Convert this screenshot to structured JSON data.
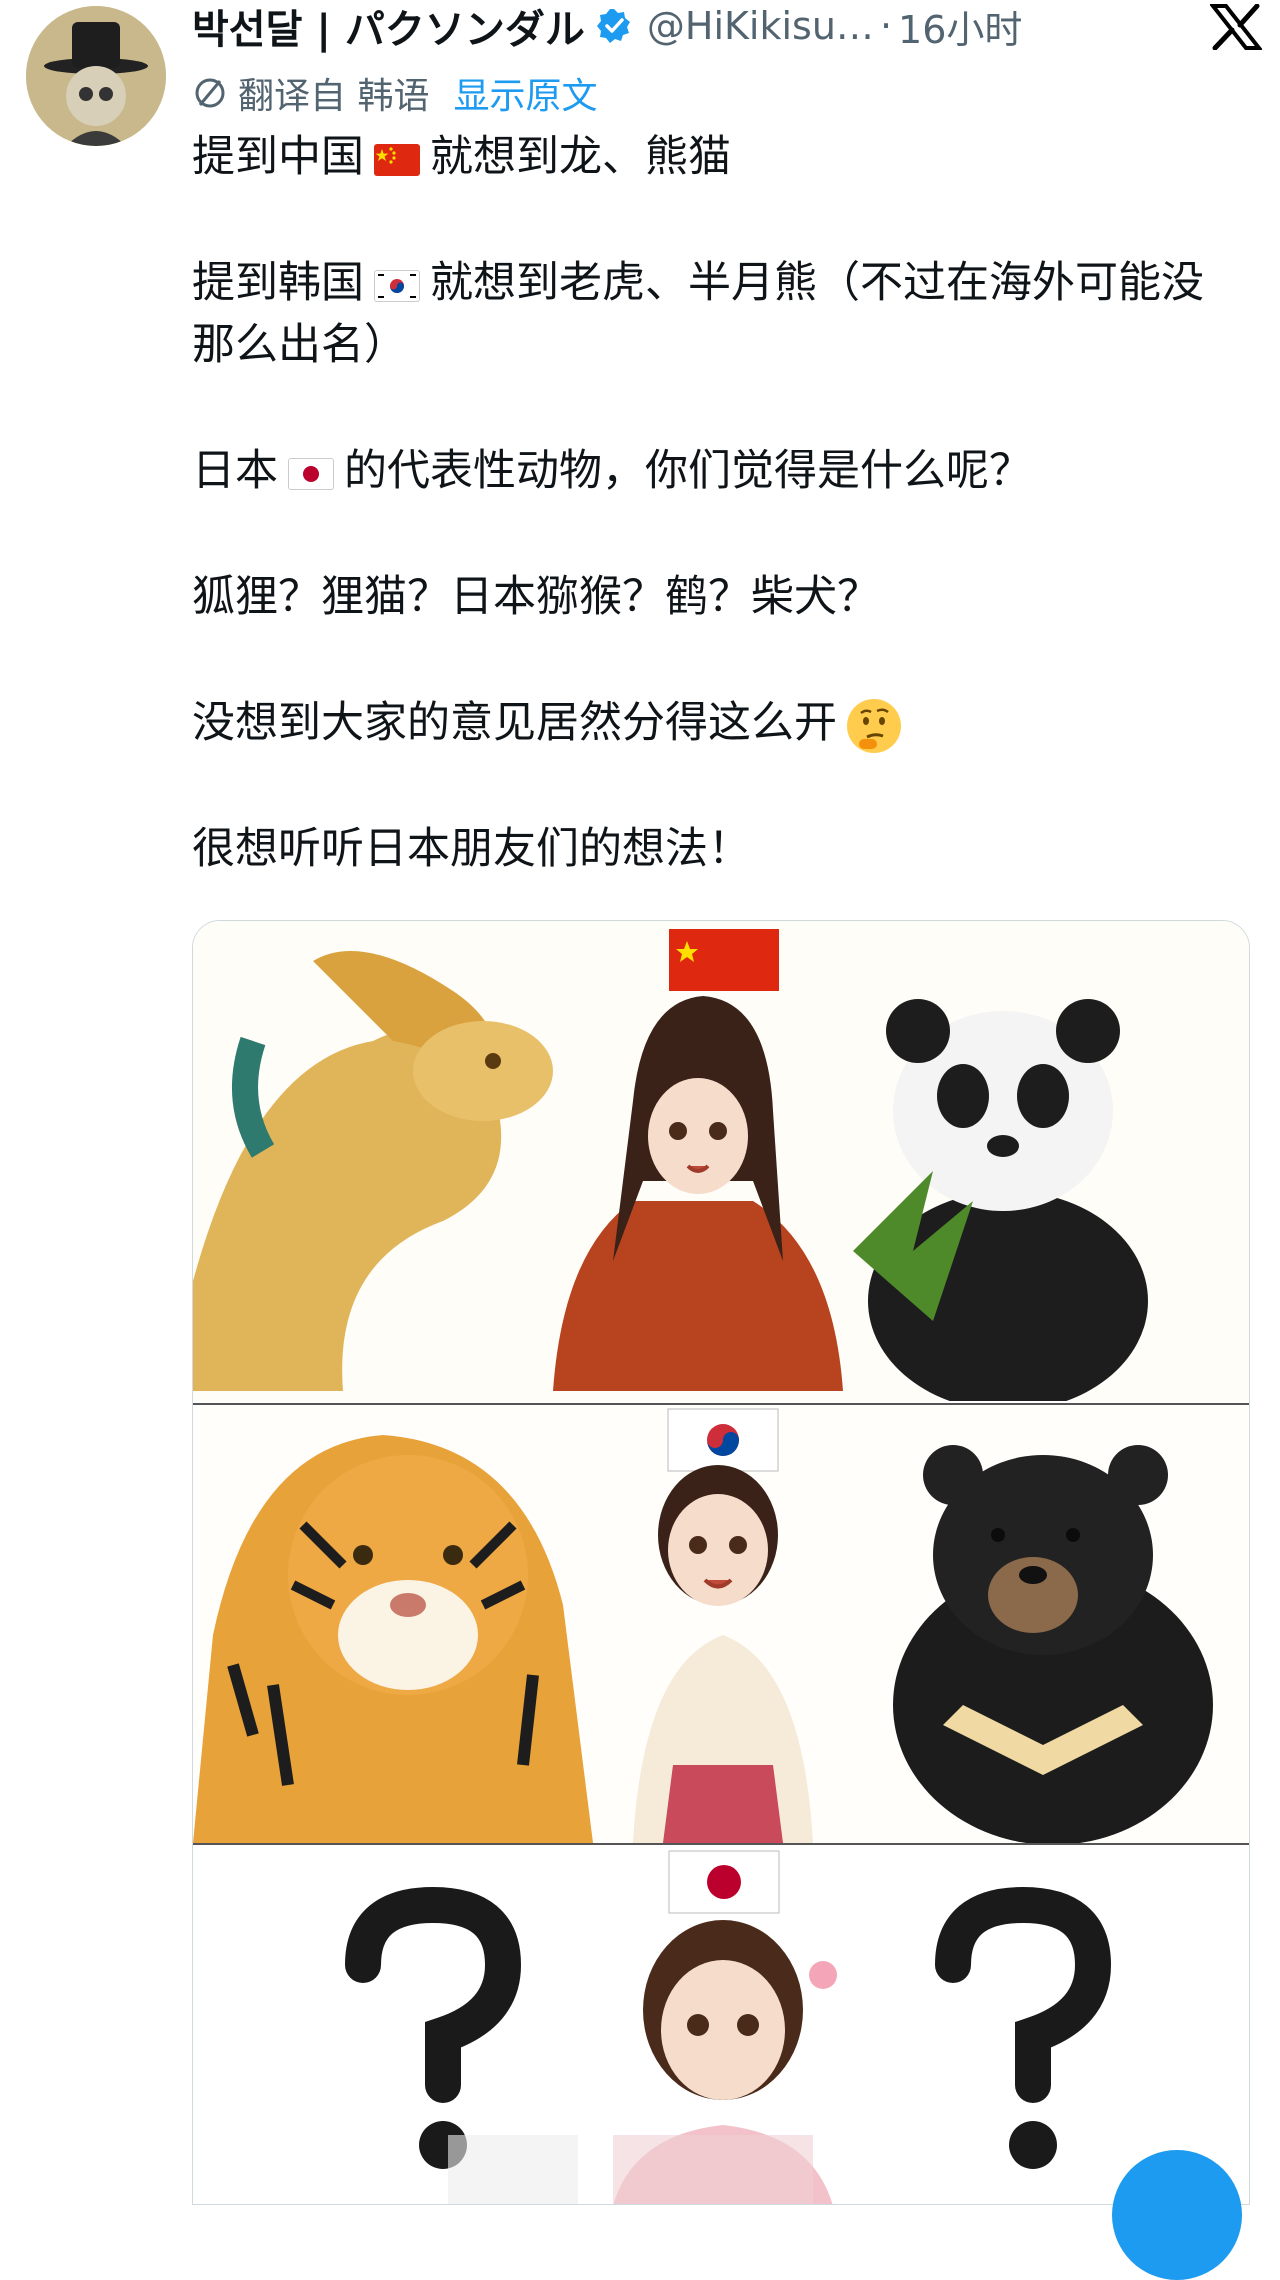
{
  "post": {
    "display_name": "박선달 | パクソンダル",
    "handle": "@HiKikisu…",
    "separator": "·",
    "time": "16小时",
    "translate_note": "翻译自 韩语",
    "show_original": "显示原文"
  },
  "body": {
    "p1_a": "提到中国",
    "p1_b": "就想到龙、熊猫",
    "p2_a": "提到韩国",
    "p2_b": "就想到老虎、半月熊（不过在海外可能没那么出名）",
    "p3_a": "日本",
    "p3_b": "的代表性动物，你们觉得是什么呢？",
    "p4": "狐狸？狸猫？日本猕猴？鹤？柴犬？",
    "p5": "没想到大家的意见居然分得这么开",
    "p6": "很想听听日本朋友们的想法！"
  },
  "colors": {
    "accent": "#1d9bf0",
    "text": "#0f1419",
    "muted": "#536471"
  },
  "icons": [
    "verified-badge-icon",
    "x-logo-icon",
    "translate-icon",
    "thinking-face-emoji",
    "china-flag",
    "korea-flag",
    "japan-flag",
    "compose-fab"
  ]
}
